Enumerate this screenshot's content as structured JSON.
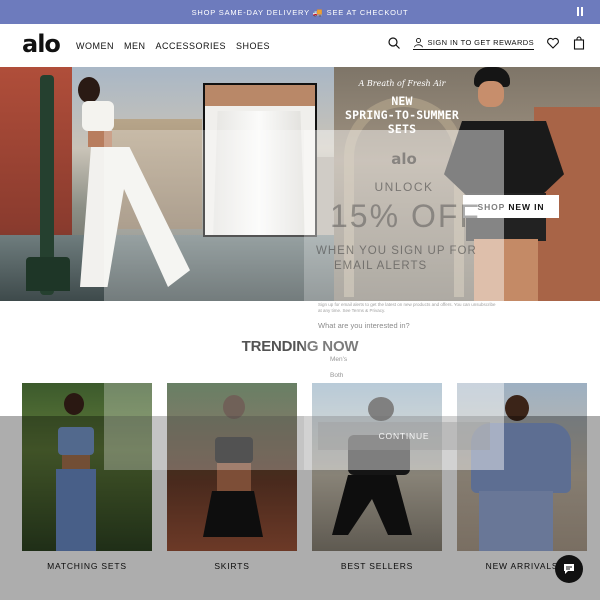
{
  "promo": {
    "text_left": "SHOP SAME-DAY DELIVERY",
    "truck_icon": "🚚",
    "text_right": "SEE AT CHECKOUT"
  },
  "header": {
    "logo": "alo",
    "nav": [
      "WOMEN",
      "MEN",
      "ACCESSORIES",
      "SHOES"
    ],
    "signin": "SIGN IN TO GET REWARDS",
    "icons": [
      "search-icon",
      "user-icon",
      "heart-icon",
      "bag-icon"
    ]
  },
  "hero": {
    "kicker": "A Breath of Fresh Air",
    "headline_1": "NEW",
    "headline_2": "SPRING-TO-SUMMER",
    "headline_3": "SETS",
    "cta": "SHOP NEW IN"
  },
  "trending": {
    "title": "TRENDING NOW",
    "tiles": [
      {
        "label": "MATCHING SETS"
      },
      {
        "label": "SKIRTS"
      },
      {
        "label": "BEST SELLERS"
      },
      {
        "label": "NEW ARRIVALS"
      }
    ]
  },
  "modal": {
    "logo": "alo",
    "unlock": "UNLOCK",
    "offer": "15% OFF",
    "when_1": "WHEN YOU SIGN UP FOR",
    "when_2": "EMAIL ALERTS",
    "fine": "Sign up for email alerts to get the latest on new products and offers. You can unsubscribe at any time. See Terms & Privacy.",
    "question": "What are you interested in?",
    "option_1": "Men's",
    "option_2": "Both",
    "continue": "CONTINUE"
  },
  "colors": {
    "promo_bg": "#6d7bbd",
    "text": "#111111",
    "cta_bg": "#ffffff"
  }
}
